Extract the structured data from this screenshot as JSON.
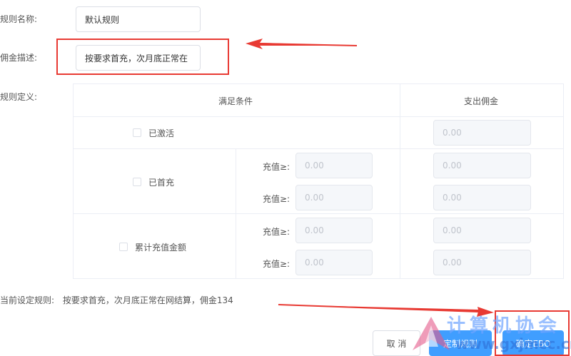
{
  "form": {
    "rule_name_label": "规则名称:",
    "rule_name_value": "默认规则",
    "commission_desc_label": "佣金描述:",
    "commission_desc_value": "按要求首充，次月底正常在",
    "rule_def_label": "规则定义:"
  },
  "table": {
    "header_condition": "满足条件",
    "header_payout": "支出佣金",
    "rows": [
      {
        "checkbox_label": "已激活",
        "payout_values": [
          "0.00"
        ]
      },
      {
        "checkbox_label": "已首充",
        "conditions": [
          {
            "label": "充值≥:",
            "value": "0.00"
          },
          {
            "label": "充值≥:",
            "value": "0.00"
          }
        ],
        "payout_values": [
          "0.00",
          "0.00"
        ]
      },
      {
        "checkbox_label": "累计充值金额",
        "conditions": [
          {
            "label": "充值≥:",
            "value": "0.00"
          },
          {
            "label": "充值≥:",
            "value": "0.00"
          }
        ],
        "payout_values": [
          "0.00",
          "0.00"
        ]
      }
    ]
  },
  "summary": {
    "label": "当前设定规则:",
    "text": "按要求首充，次月底正常在网结算，佣金134"
  },
  "buttons": {
    "cancel": "取 消",
    "primary1": "定制规则",
    "primary2": "确定EBO"
  },
  "watermark": {
    "cn": "计算机协会",
    "url": "www.gxjmcc.cn"
  },
  "colors": {
    "primary": "#409eff",
    "annotation_red": "#e83a33",
    "border": "#dcdfe6",
    "disabled_bg": "#f5f7fa"
  }
}
